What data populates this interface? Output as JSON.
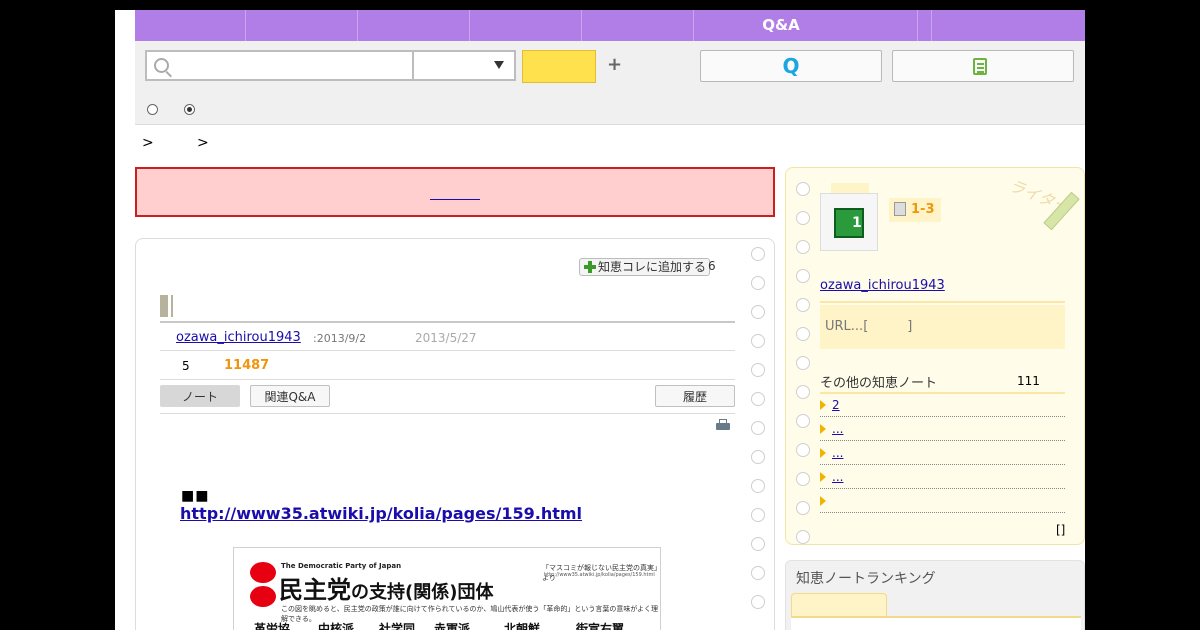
{
  "topnav": {
    "center_label": "Q&A"
  },
  "search": {
    "placeholder": ""
  },
  "breadcrumb": {
    "sep1": ">",
    "sep2": ">"
  },
  "note": {
    "add_collection_label": "知恵コレに追加する",
    "add_collection_count": "6",
    "author": "ozawa_ichirou1943",
    "created_date": ":2013/9/2",
    "updated_date": "2013/5/27",
    "stat_count": "5",
    "view_count": "11487",
    "tab_note": "ノート",
    "tab_related": "関連Q&A",
    "tab_history": "履歴",
    "body_marks": "■■",
    "body_link": "http://www35.atwiki.jp/kolia/pages/159.html"
  },
  "poster": {
    "english_title": "The Democratic Party of Japan",
    "title_main": "民主党",
    "title_rest": "の支持(関係)団体",
    "subtitle": "この図を眺めると、民主党の政策が誰に向けて作られているのか、鳩山代表が使う「革命的」という言葉の意味がよく理解できる。",
    "quote": "「マスコミが報じない民主党の真実」より",
    "source_url": "http://www35.atwiki.jp/kolia/pages/159.html",
    "column_heads": [
      "革労協",
      "中核派",
      "社学同",
      "赤軍派",
      "北朝鮮",
      "街宣右翼"
    ]
  },
  "sidebar": {
    "level_label": "1-3",
    "writer_label": "ライター",
    "author": "ozawa_ichirou1943",
    "url_text": "URL...[　　　]",
    "other_notes_label": "その他の知恵ノート",
    "other_notes_count": "111",
    "notes": [
      "2",
      "...",
      "...",
      "...",
      ""
    ],
    "bracket": "[]"
  },
  "ranking": {
    "title": "知恵ノートランキング"
  },
  "colors": {
    "nav": "#b07ee6",
    "accent_yellow": "#ffe14d",
    "alert_bg": "#ffcfcf",
    "alert_border": "#c81f1f",
    "link": "#1a0dab",
    "orange": "#f0960c"
  }
}
